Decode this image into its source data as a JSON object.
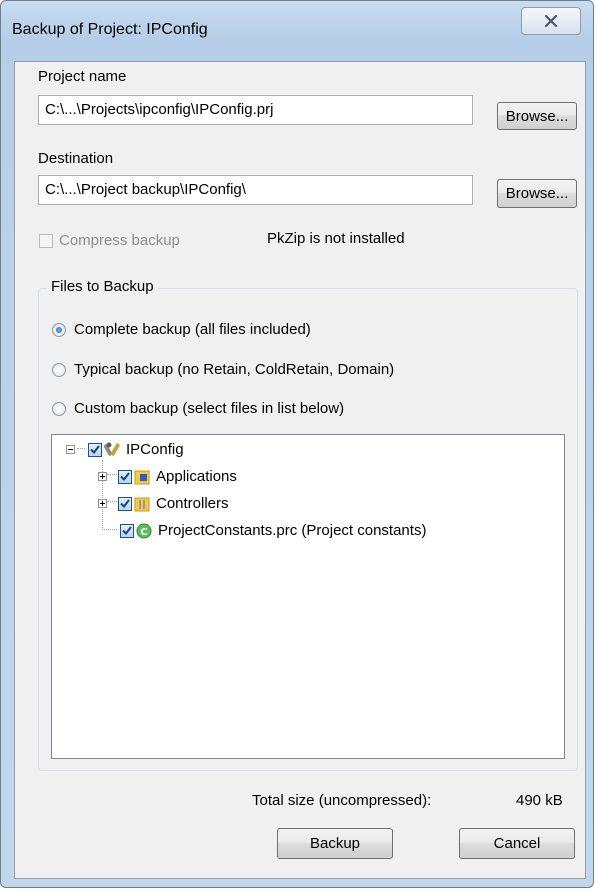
{
  "window": {
    "title": "Backup of Project: IPConfig"
  },
  "project": {
    "label": "Project name",
    "value": "C:\\...\\Projects\\ipconfig\\IPConfig.prj",
    "browse_label": "Browse..."
  },
  "destination": {
    "label": "Destination",
    "value": "C:\\...\\Project backup\\IPConfig\\",
    "browse_label": "Browse..."
  },
  "compress": {
    "label": "Compress backup",
    "checked": false,
    "enabled": false,
    "status": "PkZip is not installed"
  },
  "files_group": {
    "legend": "Files to Backup",
    "options": [
      {
        "label": "Complete backup (all files included)",
        "selected": true
      },
      {
        "label": "Typical backup (no Retain, ColdRetain, Domain)",
        "selected": false
      },
      {
        "label": "Custom backup (select files in list below)",
        "selected": false
      }
    ]
  },
  "tree": {
    "root": {
      "label": "IPConfig",
      "icon": "tools-icon",
      "checked": true,
      "expanded": true
    },
    "children": [
      {
        "label": "Applications",
        "icon": "applications-folder-icon",
        "checked": true,
        "expandable": true
      },
      {
        "label": "Controllers",
        "icon": "controllers-folder-icon",
        "checked": true,
        "expandable": true
      },
      {
        "label": "ProjectConstants.prc (Project constants)",
        "icon": "constants-icon",
        "checked": true,
        "expandable": false
      }
    ]
  },
  "summary": {
    "total_label": "Total size (uncompressed):",
    "total_value": "490 kB"
  },
  "actions": {
    "backup_label": "Backup",
    "cancel_label": "Cancel"
  }
}
